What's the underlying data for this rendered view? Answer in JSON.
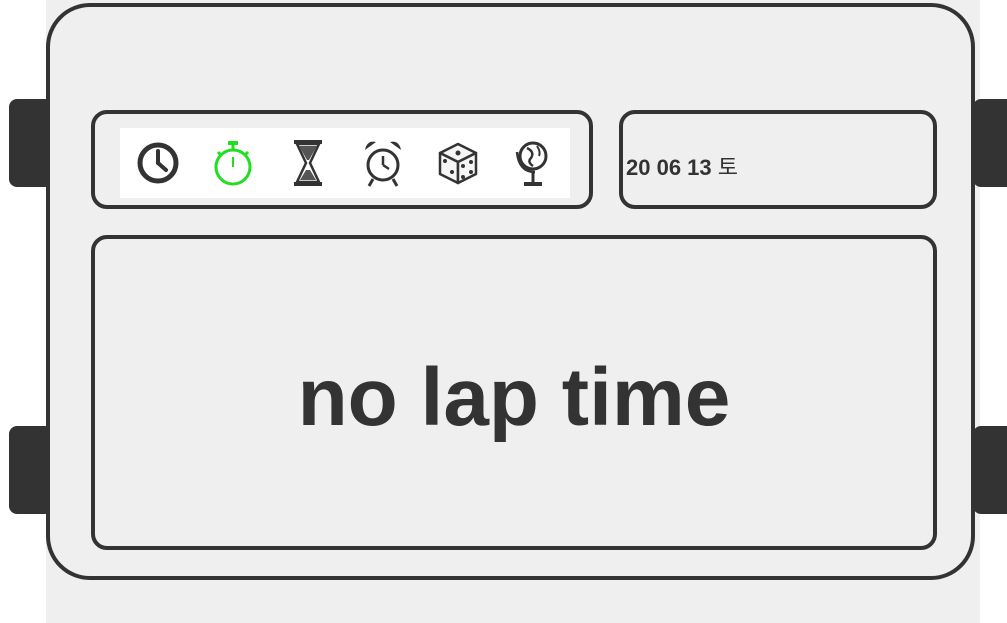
{
  "modes": [
    {
      "icon": "clock-icon",
      "active": false
    },
    {
      "icon": "stopwatch-icon",
      "active": true
    },
    {
      "icon": "hourglass-icon",
      "active": false
    },
    {
      "icon": "alarm-clock-icon",
      "active": false
    },
    {
      "icon": "dice-icon",
      "active": false
    },
    {
      "icon": "globe-icon",
      "active": false
    }
  ],
  "colors": {
    "frame": "#333333",
    "background": "#efefef",
    "active_mode": "#22dd22",
    "inactive_mode": "#333333"
  },
  "date": {
    "numbers": "20 06 13",
    "weekday": "토"
  },
  "display": {
    "message": "no lap time"
  }
}
